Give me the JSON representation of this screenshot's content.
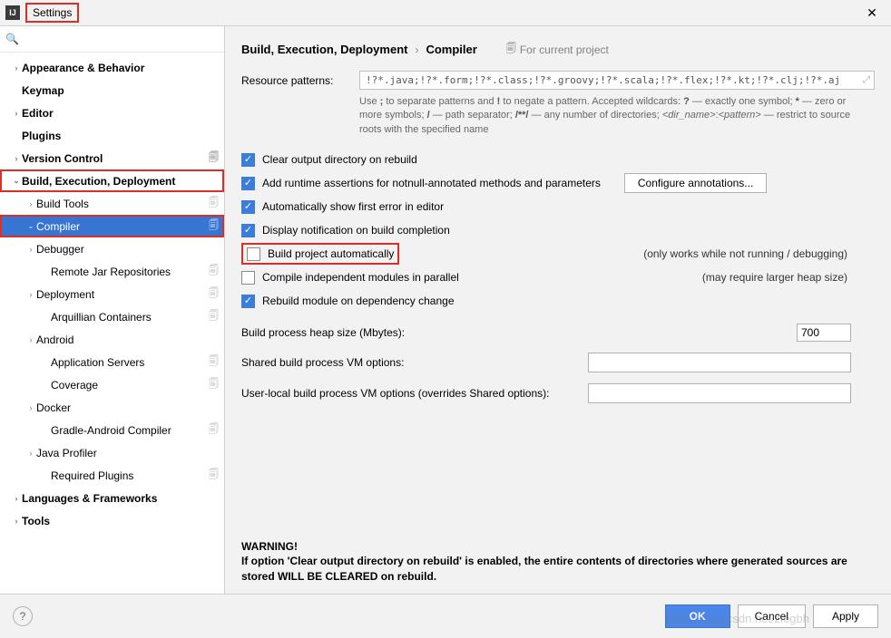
{
  "window": {
    "title": "Settings"
  },
  "search": {
    "placeholder": ""
  },
  "sidebar": {
    "items": [
      {
        "label": "Appearance & Behavior",
        "depth": 0,
        "arrow": "›",
        "proj": false
      },
      {
        "label": "Keymap",
        "depth": 0,
        "arrow": "",
        "proj": false
      },
      {
        "label": "Editor",
        "depth": 0,
        "arrow": "›",
        "proj": false
      },
      {
        "label": "Plugins",
        "depth": 0,
        "arrow": "",
        "proj": false
      },
      {
        "label": "Version Control",
        "depth": 0,
        "arrow": "›",
        "proj": true
      },
      {
        "label": "Build, Execution, Deployment",
        "depth": 0,
        "arrow": "⌄",
        "proj": false,
        "highlight": true
      },
      {
        "label": "Build Tools",
        "depth": 1,
        "arrow": "›",
        "proj": true
      },
      {
        "label": "Compiler",
        "depth": 1,
        "arrow": "⌄",
        "proj": true,
        "selected": true,
        "highlight": true
      },
      {
        "label": "Debugger",
        "depth": 1,
        "arrow": "›",
        "proj": false
      },
      {
        "label": "Remote Jar Repositories",
        "depth": 2,
        "arrow": "",
        "proj": true
      },
      {
        "label": "Deployment",
        "depth": 1,
        "arrow": "›",
        "proj": true
      },
      {
        "label": "Arquillian Containers",
        "depth": 2,
        "arrow": "",
        "proj": true
      },
      {
        "label": "Android",
        "depth": 1,
        "arrow": "›",
        "proj": false
      },
      {
        "label": "Application Servers",
        "depth": 2,
        "arrow": "",
        "proj": true
      },
      {
        "label": "Coverage",
        "depth": 2,
        "arrow": "",
        "proj": true
      },
      {
        "label": "Docker",
        "depth": 1,
        "arrow": "›",
        "proj": false
      },
      {
        "label": "Gradle-Android Compiler",
        "depth": 2,
        "arrow": "",
        "proj": true
      },
      {
        "label": "Java Profiler",
        "depth": 1,
        "arrow": "›",
        "proj": false
      },
      {
        "label": "Required Plugins",
        "depth": 2,
        "arrow": "",
        "proj": true
      },
      {
        "label": "Languages & Frameworks",
        "depth": 0,
        "arrow": "›",
        "proj": false
      },
      {
        "label": "Tools",
        "depth": 0,
        "arrow": "›",
        "proj": false
      }
    ]
  },
  "breadcrumb": {
    "root": "Build, Execution, Deployment",
    "leaf": "Compiler",
    "scope": "For current project"
  },
  "form": {
    "patterns_label": "Resource patterns:",
    "patterns_value": "!?*.java;!?*.form;!?*.class;!?*.groovy;!?*.scala;!?*.flex;!?*.kt;!?*.clj;!?*.aj",
    "hint": "Use ; to separate patterns and ! to negate a pattern. Accepted wildcards: ? — exactly one symbol; * — zero or more symbols; / — path separator; /**/ — any number of directories; <dir_name>:<pattern> — restrict to source roots with the specified name",
    "checks": [
      {
        "label": "Clear output directory on rebuild",
        "checked": true
      },
      {
        "label": "Add runtime assertions for notnull-annotated methods and parameters",
        "checked": true,
        "button": "Configure annotations..."
      },
      {
        "label": "Automatically show first error in editor",
        "checked": true
      },
      {
        "label": "Display notification on build completion",
        "checked": true
      },
      {
        "label": "Build project automatically",
        "checked": false,
        "note": "(only works while not running / debugging)",
        "highlight": true
      },
      {
        "label": "Compile independent modules in parallel",
        "checked": false,
        "note": "(may require larger heap size)"
      },
      {
        "label": "Rebuild module on dependency change",
        "checked": true
      }
    ],
    "heap_label": "Build process heap size (Mbytes):",
    "heap_value": "700",
    "shared_vm_label": "Shared build process VM options:",
    "shared_vm_value": "",
    "user_vm_label": "User-local build process VM options (overrides Shared options):",
    "user_vm_value": ""
  },
  "warning": {
    "title": "WARNING!",
    "body": "If option 'Clear output directory on rebuild' is enabled, the entire contents of directories where generated sources are stored WILL BE CLEARED on rebuild."
  },
  "footer": {
    "ok": "OK",
    "cancel": "Cancel",
    "apply": "Apply"
  }
}
